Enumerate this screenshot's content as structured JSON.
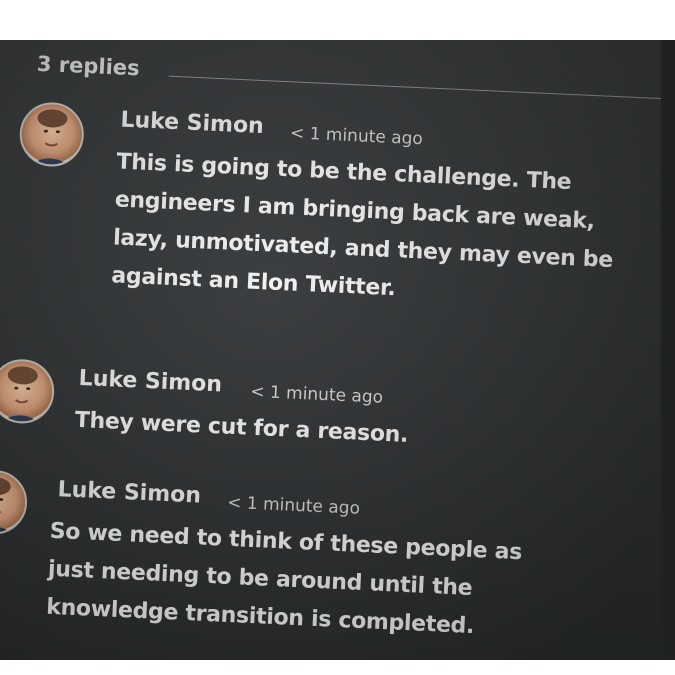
{
  "thread": {
    "replies_label": "3 replies"
  },
  "messages": [
    {
      "author": "Luke Simon",
      "time": "< 1 minute ago",
      "lines": [
        "This is going to be the challenge.  The",
        "engineers I am bringing back are weak,",
        "lazy, unmotivated, and they may even be",
        "against an Elon Twitter."
      ]
    },
    {
      "author": "Luke Simon",
      "time": "< 1 minute ago",
      "lines": [
        "They were cut for a reason."
      ]
    },
    {
      "author": "Luke Simon",
      "time": "< 1 minute ago",
      "lines": [
        "So we need to think of these people as",
        "just needing to be around until the",
        "knowledge transition is completed."
      ]
    }
  ],
  "colors": {
    "panel_bg": "#333638",
    "text": "#f2f2f2",
    "muted": "#d2d2d2",
    "divider": "#8a8d8f"
  },
  "icons": {
    "avatar": "user-avatar-photo"
  }
}
